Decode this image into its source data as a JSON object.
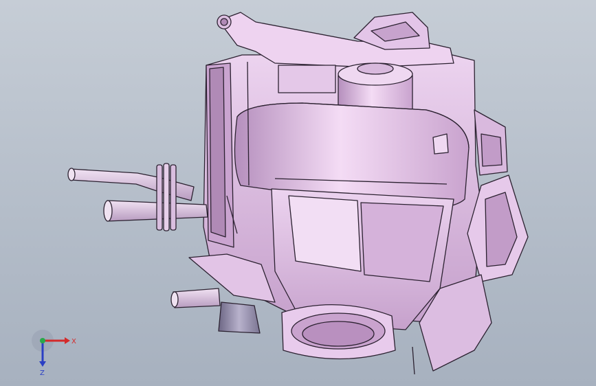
{
  "viewport": {
    "background_top": "#c6cdd6",
    "background_bottom": "#a7b1bf"
  },
  "model": {
    "part_color": "#e7c6ea",
    "part_shade": "#b994bd",
    "edge_color": "#2b2130",
    "hose_color": "#dcc2e0",
    "dark_block_color": "#8f8aa4"
  },
  "triad": {
    "x_label": "X",
    "z_label": "Z",
    "x_color": "#d42a2a",
    "y_color": "#2aa84a",
    "z_color": "#2a3fc4"
  }
}
